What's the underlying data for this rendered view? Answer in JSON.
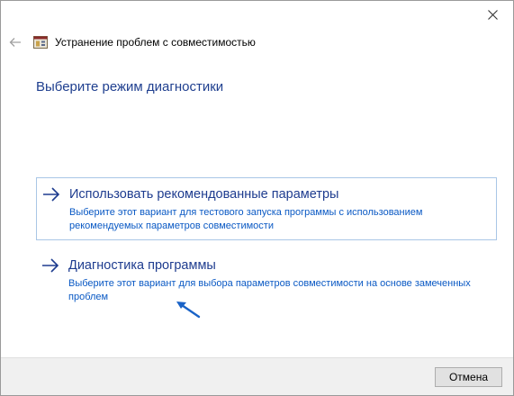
{
  "window": {
    "title": "Устранение проблем с совместимостью",
    "close_glyph": "✕"
  },
  "page": {
    "heading": "Выберите режим диагностики"
  },
  "options": [
    {
      "title": "Использовать рекомендованные параметры",
      "description": "Выберите этот вариант для тестового запуска программы с использованием рекомендуемых параметров совместимости",
      "icon": "arrow-right-icon"
    },
    {
      "title": "Диагностика программы",
      "description": "Выберите этот вариант для выбора параметров совместимости на основе замеченных проблем",
      "icon": "arrow-right-icon"
    }
  ],
  "footer": {
    "cancel_label": "Отмена"
  },
  "colors": {
    "accent": "#1e3c8f",
    "link": "#0a59c4",
    "focus_border": "#a9c6e6",
    "pointer_arrow": "#1a63c7"
  }
}
